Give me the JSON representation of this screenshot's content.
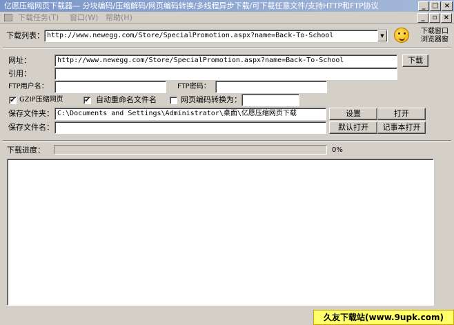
{
  "window": {
    "title": "亿愿压缩网页下载器— 分块编码/压缩解码/网页编码转换/多线程异步下载/可下载任意文件/支持HTTP和FTP协议"
  },
  "menu": {
    "items": [
      "下载任务(T)",
      "窗口(W)",
      "帮助(H)"
    ]
  },
  "toolbar": {
    "download_list_label": "下载列表：",
    "download_list_value": "http://www.newegg.com/Store/SpecialPromotion.aspx?name=Back-To-School",
    "download_window_label_line1": "下载窗口",
    "download_window_label_line2": "浏览器窗"
  },
  "form": {
    "url_label": "网址：",
    "url_value": "http://www.newegg.com/Store/SpecialPromotion.aspx?name=Back-To-School",
    "download_button": "下载",
    "referer_label": "引用：",
    "referer_value": "",
    "ftp_user_label": "FTP用户名：",
    "ftp_user_value": "",
    "ftp_password_label": "FTP密码：",
    "ftp_password_value": "",
    "gzip_label": "GZIP压缩网页",
    "gzip_checked": "✔",
    "auto_rename_label": "自动重命名文件名",
    "auto_rename_checked": "✔",
    "encoding_label": "网页编码转换为：",
    "encoding_checked": "",
    "encoding_value": "",
    "save_folder_label": "保存文件夹：",
    "save_folder_value": "C:\\Documents and Settings\\Administrator\\桌面\\亿愿压缩网页下载",
    "settings_button": "设置",
    "open_button": "打开",
    "save_filename_label": "保存文件名：",
    "save_filename_value": "",
    "default_open_button": "默认打开",
    "notepad_open_button": "记事本打开"
  },
  "progress": {
    "label": "下载进度：",
    "value": "0%",
    "fraction": 0
  },
  "watermark": {
    "text": "久友下载站(www.9upk.com)"
  },
  "colors": {
    "face": "#d4d0c8",
    "title_start": "#7a96c8",
    "title_end": "#a6b9da",
    "watermark": "#ffff6a"
  }
}
